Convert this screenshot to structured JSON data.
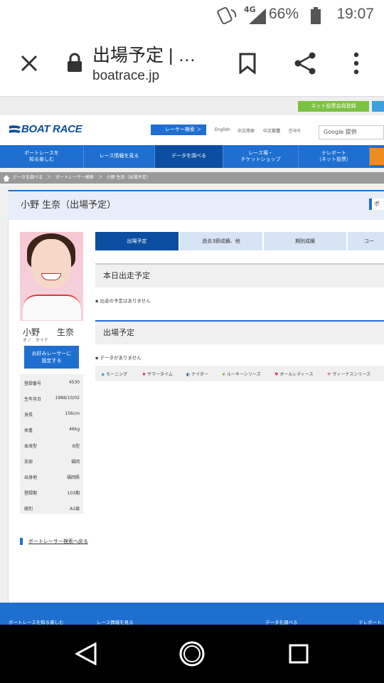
{
  "status": {
    "network": "4G",
    "battery": "66%",
    "time": "19:07"
  },
  "appbar": {
    "title": "出場予定 | …",
    "url": "boatrace.jp"
  },
  "site": {
    "register": "ネット投票会員登録",
    "logo": "BOAT RACE",
    "racer_search": "レーサー検索",
    "langs": [
      "English",
      "中文简体",
      "中文繁體",
      "한국어"
    ],
    "google": "Google 提供",
    "nav": [
      "ボートレースを\n知る楽しむ",
      "レース情報を見る",
      "データを調べる",
      "レース場・\nチケットショップ",
      "テレボート\n（ネット投票）"
    ],
    "breadcrumb": "データを調べる　＞　ボートレーサー検索　＞　小野 生奈（出場予定）",
    "page_title": "小野 生奈（出場予定）",
    "right_tag": "ボ"
  },
  "racer": {
    "name": "小野　　生奈",
    "kana": "オノ　セイナ",
    "fav_button": "お好みレーサーに\n設定する",
    "profile": [
      {
        "label": "登録番号",
        "value": "4530"
      },
      {
        "label": "生年月日",
        "value": "1988/10/02"
      },
      {
        "label": "身長",
        "value": "156cm"
      },
      {
        "label": "体重",
        "value": "46kg"
      },
      {
        "label": "血液型",
        "value": "B型"
      },
      {
        "label": "支部",
        "value": "福岡"
      },
      {
        "label": "出身地",
        "value": "福岡県"
      },
      {
        "label": "登録期",
        "value": "103期"
      },
      {
        "label": "級別",
        "value": "A1級"
      }
    ]
  },
  "tabs": [
    "出場予定",
    "過去3節成績、他",
    "期別成績",
    "コー"
  ],
  "today": {
    "heading": "本日出走予定",
    "note": "出走の予定はありません"
  },
  "schedule": {
    "heading": "出場予定",
    "note": "データがありません"
  },
  "legend": [
    "モーニング",
    "サマータイム",
    "ナイター",
    "ルーキーシリーズ",
    "オールレディース",
    "ヴィーナスシリーズ"
  ],
  "back_link": "ボートレーサー検索へ戻る",
  "footer": [
    "ボートレースを知る楽しむ",
    "レース情報を見る",
    "データを調べる",
    "テレボート"
  ],
  "colors": {
    "brand": "#1e6fd0",
    "dark": "#0c4ea0",
    "green": "#7cc242",
    "orange": "#f08c1e"
  }
}
